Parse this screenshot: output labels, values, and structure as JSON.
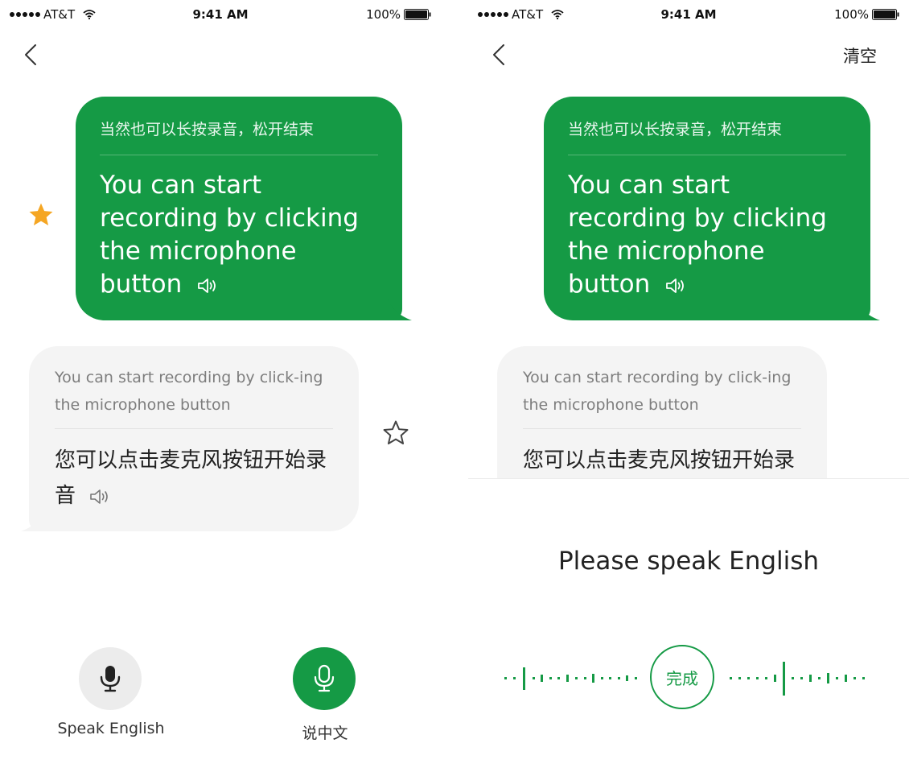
{
  "colors": {
    "accent": "#159a45",
    "star": "#f5a623",
    "bubble_gray": "#f4f4f4"
  },
  "status_bar": {
    "carrier": "AT&T",
    "time": "9:41 AM",
    "battery": "100%"
  },
  "translation": {
    "user_source": "当然也可以长按录音，松开结束",
    "user_translation": "You can start recording by clicking the microphone button",
    "reply_source": "You can start recording by click-ing the microphone button",
    "reply_translation": "您可以点击麦克风按钮开始录音"
  },
  "left_screen": {
    "speak_english_label": "Speak English",
    "speak_chinese_label": "说中文"
  },
  "right_screen": {
    "clear_label": "清空",
    "listening_prompt": "Please speak English",
    "done_label": "完成"
  },
  "icons": [
    "back-chevron-icon",
    "star-filled-icon",
    "star-outline-icon",
    "speaker-icon",
    "microphone-icon",
    "wifi-icon",
    "battery-icon",
    "signal-dots-icon"
  ]
}
